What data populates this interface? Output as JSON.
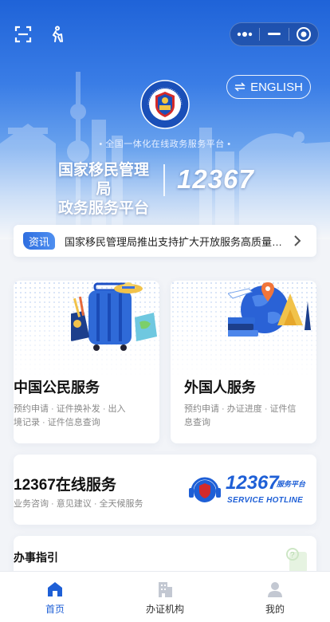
{
  "header": {
    "lang_button": "ENGLISH",
    "emblem_text": "中国移民管理 · CHINA IMMIGRATION",
    "subtitle": "• 全国一体化在线政务服务平台 •",
    "title_line1": "国家移民管理局",
    "title_line2": "政务服务平台",
    "hotline": "12367"
  },
  "news": {
    "tag": "资讯",
    "text": "国家移民管理局推出支持扩大开放服务高质量发展便利措施"
  },
  "cards": {
    "citizen": {
      "title": "中国公民服务",
      "desc": "预约申请 · 证件换补发 · 出入境记录 · 证件信息查询"
    },
    "foreigner": {
      "title": "外国人服务",
      "desc": "预约申请 · 办证进度 · 证件信息查询"
    },
    "hotline": {
      "title": "12367在线服务",
      "desc": "业务咨询 · 意见建议 · 全天候服务",
      "logo_number": "12367",
      "logo_tag": "服务平台",
      "logo_sub": "SERVICE HOTLINE"
    },
    "guide": {
      "title": "办事指引"
    }
  },
  "tabbar": {
    "items": [
      {
        "label": "首页",
        "active": true
      },
      {
        "label": "办证机构",
        "active": false
      },
      {
        "label": "我的",
        "active": false
      }
    ]
  },
  "colors": {
    "primary": "#1e5fd6",
    "hero_top": "#1f63d8",
    "inactive_icon": "#c3c8d2"
  }
}
